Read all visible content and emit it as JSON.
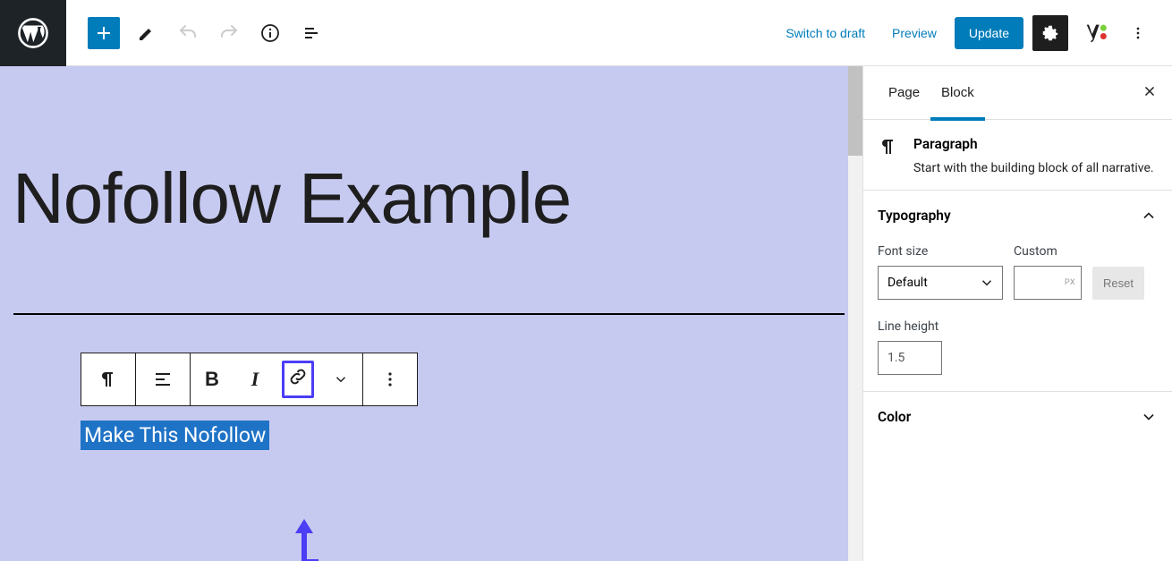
{
  "topbar": {
    "switch_draft": "Switch to draft",
    "preview": "Preview",
    "update": "Update"
  },
  "editor": {
    "page_title": "Nofollow Example",
    "selected_text": "Make This Nofollow"
  },
  "block_toolbar": {
    "bold": "B",
    "italic": "I"
  },
  "sidebar": {
    "tabs": {
      "page": "Page",
      "block": "Block"
    },
    "block_header": {
      "title": "Paragraph",
      "desc": "Start with the building block of all narrative."
    },
    "typography": {
      "title": "Typography",
      "font_size_label": "Font size",
      "custom_label": "Custom",
      "font_size_value": "Default",
      "px_suffix": "PX",
      "reset": "Reset",
      "line_height_label": "Line height",
      "line_height_value": "1.5"
    },
    "color": {
      "title": "Color"
    }
  }
}
